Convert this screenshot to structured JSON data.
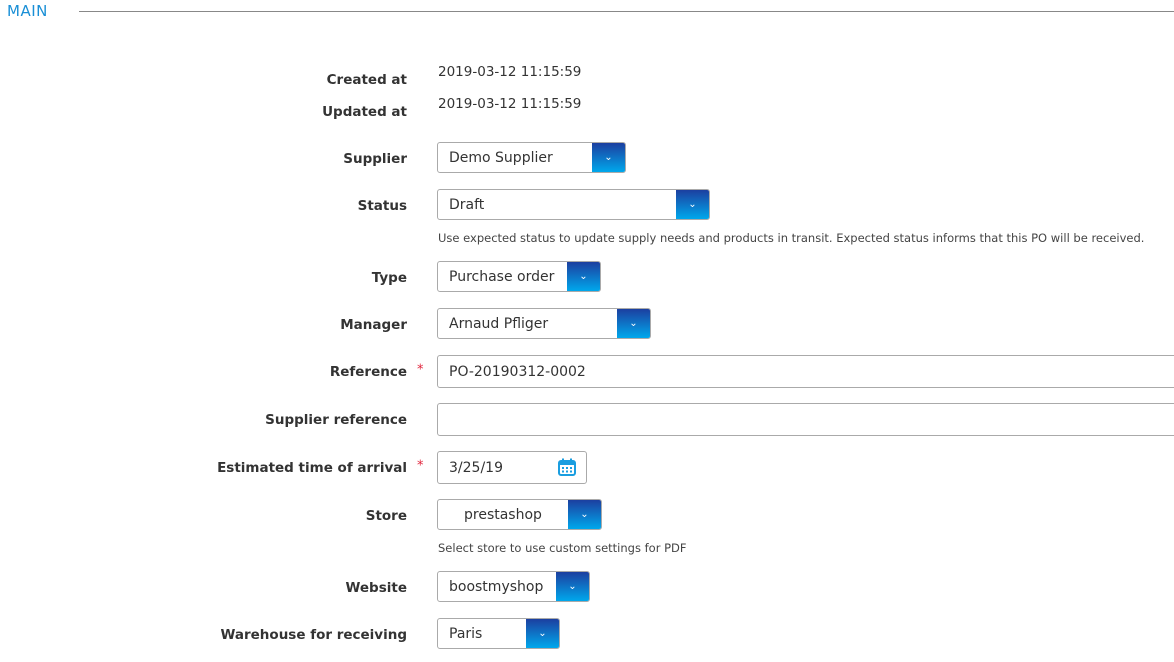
{
  "section": {
    "title": "MAIN"
  },
  "fields": {
    "created_at": {
      "label": "Created at",
      "value": "2019-03-12 11:15:59"
    },
    "updated_at": {
      "label": "Updated at",
      "value": "2019-03-12 11:15:59"
    },
    "supplier": {
      "label": "Supplier",
      "value": "Demo Supplier"
    },
    "status": {
      "label": "Status",
      "value": "Draft",
      "help": "Use expected status to update supply needs and products in transit. Expected status informs that this PO will be received."
    },
    "type": {
      "label": "Type",
      "value": "Purchase order"
    },
    "manager": {
      "label": "Manager",
      "value": "Arnaud Pfliger"
    },
    "reference": {
      "label": "Reference",
      "value": "PO-20190312-0002",
      "required": "*"
    },
    "supplier_reference": {
      "label": "Supplier reference",
      "value": ""
    },
    "eta": {
      "label": "Estimated time of arrival",
      "value": "3/25/19",
      "required": "*"
    },
    "store": {
      "label": "Store",
      "value": "prestashop",
      "help": "Select store to use custom settings for PDF"
    },
    "website": {
      "label": "Website",
      "value": "boostmyshop"
    },
    "warehouse": {
      "label": "Warehouse for receiving",
      "value": "Paris"
    }
  },
  "icons": {
    "dropdown": "chevron-down-icon",
    "calendar": "calendar-icon"
  },
  "colors": {
    "accent": "#1a8fd6",
    "required": "#e0223a"
  }
}
